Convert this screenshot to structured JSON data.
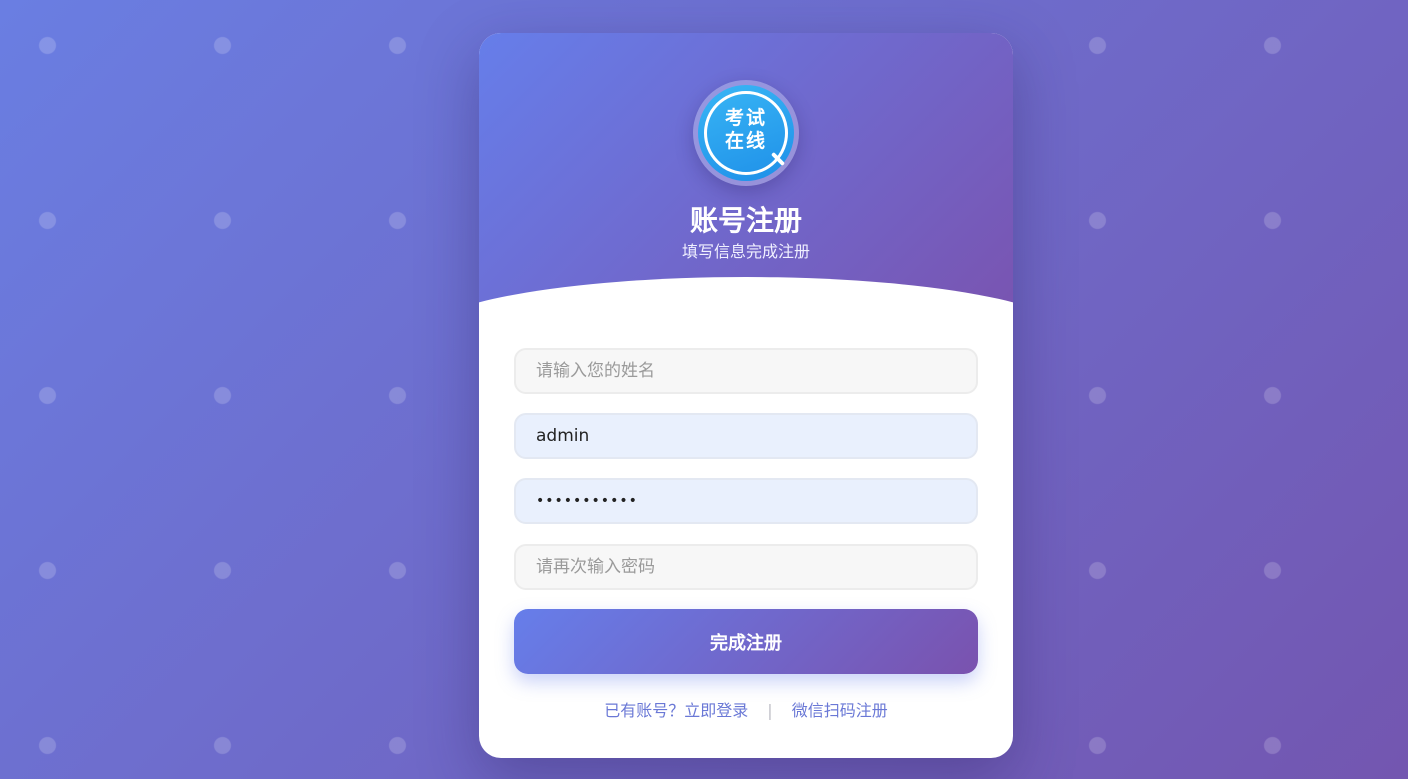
{
  "logo": {
    "line1": "考试",
    "line2": "在线",
    "icon": "search-icon"
  },
  "header": {
    "title": "账号注册",
    "subtitle": "填写信息完成注册"
  },
  "form": {
    "name_placeholder": "请输入您的姓名",
    "username_value": "admin",
    "password_value": "admin123456",
    "confirm_placeholder": "请再次输入密码",
    "submit_label": "完成注册"
  },
  "links": {
    "login": "已有账号？立即登录",
    "separator": "|",
    "wechat": "微信扫码注册"
  },
  "colors": {
    "accent_start": "#667eea",
    "accent_end": "#7a52ae",
    "link": "#6a78d6"
  }
}
